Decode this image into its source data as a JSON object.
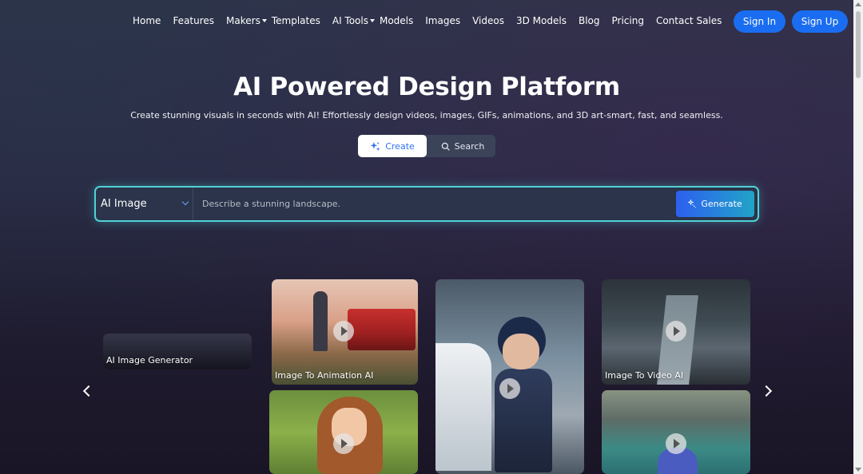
{
  "nav": {
    "links": [
      {
        "label": "Home"
      },
      {
        "label": "Features"
      },
      {
        "label": "Makers"
      },
      {
        "label": "Templates"
      },
      {
        "label": "AI Tools"
      },
      {
        "label": "Models"
      },
      {
        "label": "Images"
      },
      {
        "label": "Videos"
      },
      {
        "label": "3D Models"
      },
      {
        "label": "Blog"
      },
      {
        "label": "Pricing"
      },
      {
        "label": "Contact Sales"
      }
    ],
    "sign_in": "Sign In",
    "sign_up": "Sign Up"
  },
  "hero": {
    "title": "AI Powered Design Platform",
    "subtitle": "Create stunning visuals in seconds with AI! Effortlessly design videos, images, GIFs, animations, and 3D art-smart, fast, and seamless."
  },
  "mode": {
    "create_label": "Create",
    "search_label": "Search",
    "selected": "Create"
  },
  "prompt": {
    "type_selected": "AI Image",
    "placeholder": "Describe a stunning landscape.",
    "value": "",
    "generate_label": "Generate"
  },
  "gallery": {
    "cards": [
      {
        "label": "AI Image Generator"
      },
      {
        "label": "Image To Animation AI"
      },
      {
        "label": ""
      },
      {
        "label": "Image To Video AI"
      },
      {
        "label": ""
      },
      {
        "label": ""
      }
    ]
  },
  "colors": {
    "accent": "#1a6df0",
    "prompt_border": "#4fd2d6",
    "create_text": "#2e74f0"
  },
  "icons": {
    "create": "sparkles-icon",
    "search": "search-icon",
    "generate": "sparkle-wand-icon",
    "dropdown": "chevron-down-icon",
    "prev": "chevron-left-icon",
    "next": "chevron-right-icon",
    "play": "play-icon"
  }
}
